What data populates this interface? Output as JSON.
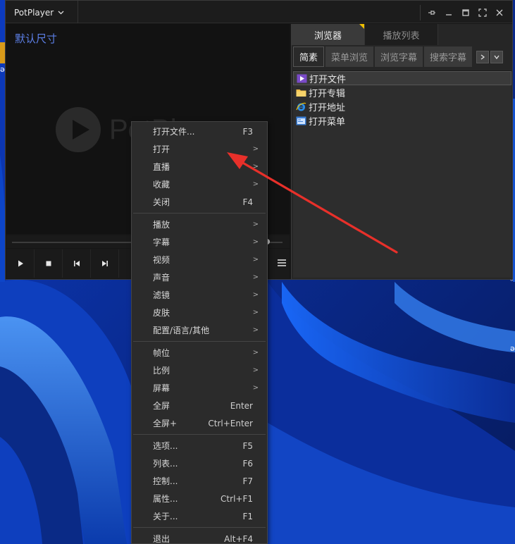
{
  "window": {
    "app_menu_label": "PotPlayer",
    "size_label": "默认尺寸",
    "logo_text": "PotPlayer"
  },
  "panel": {
    "tabs": [
      "浏览器",
      "播放列表"
    ],
    "sub_tabs": [
      "简素",
      "菜单浏览",
      "浏览字幕",
      "搜索字幕"
    ],
    "items": [
      {
        "label": "打开文件",
        "icon": "video-file-icon"
      },
      {
        "label": "打开专辑",
        "icon": "folder-icon"
      },
      {
        "label": "打开地址",
        "icon": "internet-explorer-icon"
      },
      {
        "label": "打开菜单",
        "icon": "menu-dialog-icon"
      }
    ]
  },
  "context_menu": {
    "groups": [
      [
        {
          "label": "打开文件...",
          "shortcut": "F3",
          "submenu": false
        },
        {
          "label": "打开",
          "shortcut": "",
          "submenu": true
        },
        {
          "label": "直播",
          "shortcut": "",
          "submenu": true
        },
        {
          "label": "收藏",
          "shortcut": "",
          "submenu": true
        },
        {
          "label": "关闭",
          "shortcut": "F4",
          "submenu": false
        }
      ],
      [
        {
          "label": "播放",
          "shortcut": "",
          "submenu": true
        },
        {
          "label": "字幕",
          "shortcut": "",
          "submenu": true
        },
        {
          "label": "视频",
          "shortcut": "",
          "submenu": true
        },
        {
          "label": "声音",
          "shortcut": "",
          "submenu": true
        },
        {
          "label": "滤镜",
          "shortcut": "",
          "submenu": true
        },
        {
          "label": "皮肤",
          "shortcut": "",
          "submenu": true
        },
        {
          "label": "配置/语言/其他",
          "shortcut": "",
          "submenu": true
        }
      ],
      [
        {
          "label": "帧位",
          "shortcut": "",
          "submenu": true
        },
        {
          "label": "比例",
          "shortcut": "",
          "submenu": true
        },
        {
          "label": "屏幕",
          "shortcut": "",
          "submenu": true
        },
        {
          "label": "全屏",
          "shortcut": "Enter",
          "submenu": false
        },
        {
          "label": "全屏+",
          "shortcut": "Ctrl+Enter",
          "submenu": false
        }
      ],
      [
        {
          "label": "选项...",
          "shortcut": "F5",
          "submenu": false
        },
        {
          "label": "列表...",
          "shortcut": "F6",
          "submenu": false
        },
        {
          "label": "控制...",
          "shortcut": "F7",
          "submenu": false
        },
        {
          "label": "属性...",
          "shortcut": "Ctrl+F1",
          "submenu": false
        },
        {
          "label": "关于...",
          "shortcut": "F1",
          "submenu": false
        }
      ],
      [
        {
          "label": "退出",
          "shortcut": "Alt+F4",
          "submenu": false
        }
      ]
    ],
    "submenu_glyph": ">"
  },
  "colors": {
    "accent_label": "#5c7fe6",
    "annotation_arrow": "#e8302a",
    "tab_marker": "#f0c000"
  }
}
